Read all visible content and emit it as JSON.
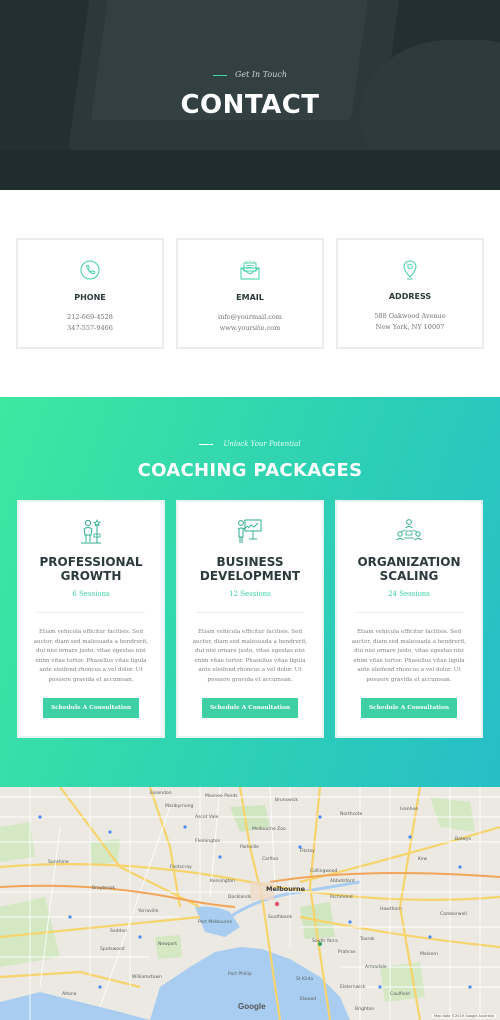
{
  "hero": {
    "tagline": "Get In Touch",
    "title": "CONTACT"
  },
  "contact": {
    "cards": [
      {
        "icon": "phone-icon",
        "title": "PHONE",
        "lines": [
          "212-669-4528",
          "347-557-9466"
        ]
      },
      {
        "icon": "email-icon",
        "title": "EMAIL",
        "lines": [
          "info@yourmail.com",
          "www.yoursite.com"
        ]
      },
      {
        "icon": "location-pin-icon",
        "title": "ADDRESS",
        "lines": [
          "588 Oakwood Avenue",
          "New York, NY 10007"
        ]
      }
    ]
  },
  "packages": {
    "tagline": "Unlock Your Potential",
    "title": "COACHING PACKAGES",
    "cards": [
      {
        "icon": "person-goal-icon",
        "title": "PROFESSIONAL GROWTH",
        "sessions": "6 Sessions",
        "description": "Etiam vehicula efficitur facilisis. Sed auctor, diam sed malesuada a hendrerit, dui nisi ornare justo, vitae egestas nisi enim vitae tortor. Phasellus vitae ligula ante eleifend rhoncus a vel dolor. Ut posuere gravida et accumsan.",
        "button": "Schedule A Consultation"
      },
      {
        "icon": "presentation-icon",
        "title": "BUSINESS DEVELOPMENT",
        "sessions": "12 Sessions",
        "description": "Etiam vehicula efficitur facilisis. Sed auctor, diam sed malesuada a hendrerit, dui nisi ornare justo, vitae egestas nisi enim vitae tortor. Phasellus vitae ligula ante eleifend rhoncus a vel dolor. Ut posuere gravida et accumsan.",
        "button": "Schedule A Consultation"
      },
      {
        "icon": "team-network-icon",
        "title": "ORGANIZATION SCALING",
        "sessions": "24 Sessions",
        "description": "Etiam vehicula efficitur facilisis. Sed auctor, diam sed malesuada a hendrerit, dui nisi ornare justo, vitae egestas nisi enim vitae tortor. Phasellus vitae ligula ante eleifend rhoncus a vel dolor. Ut posuere gravida et accumsan.",
        "button": "Schedule A Consultation"
      }
    ]
  },
  "map": {
    "city": "Melbourne",
    "places": [
      "Moonee Ponds",
      "Brunswick",
      "Maribyrnong",
      "Ascot Vale",
      "Flemington",
      "Melbourne Zoo",
      "Carlton",
      "Fitzroy",
      "Collingwood",
      "Richmond",
      "Footscray",
      "Docklands",
      "Southbank",
      "South Yarra",
      "Port Melbourne",
      "St Kilda",
      "Williamstown",
      "Newport",
      "Altona",
      "Sunshine",
      "Braybrook",
      "Kew",
      "Hawthorn",
      "Camberwell",
      "Malvern",
      "Caulfield",
      "Prahran",
      "Brighton",
      "Elsternwick",
      "Essendon",
      "Northcote",
      "Ivanhoe",
      "Balwyn",
      "Yarraville",
      "Spotswood",
      "Seddon",
      "Kensington",
      "Parkville",
      "Abbotsford",
      "Toorak",
      "Armadale",
      "Elwood",
      "Port Phillip"
    ],
    "google": "Google",
    "credit": "Map data ©2019 Google   Australia"
  },
  "colors": {
    "accent": "#3fcfa4",
    "gradient_start": "#3ee8a0",
    "gradient_end": "#27bec8",
    "dark": "#2d3a3c"
  }
}
